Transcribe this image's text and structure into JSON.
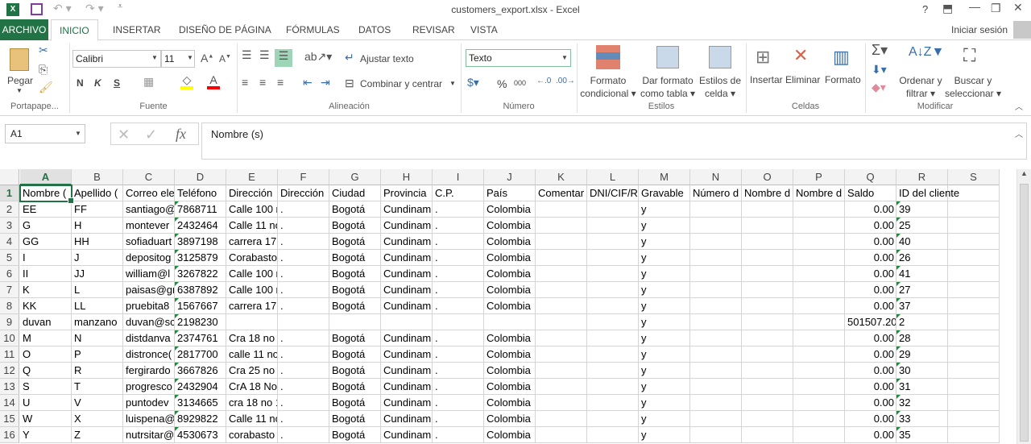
{
  "window": {
    "title": "customers_export.xlsx - Excel",
    "help": "?",
    "signin": "Iniciar sesión"
  },
  "tabs": [
    "ARCHIVO",
    "INICIO",
    "INSERTAR",
    "DISEÑO DE PÁGINA",
    "FÓRMULAS",
    "DATOS",
    "REVISAR",
    "VISTA"
  ],
  "ribbon": {
    "paste": "Pegar",
    "font_name": "Calibri",
    "font_size": "11",
    "bold": "N",
    "italic": "K",
    "underline": "S",
    "wrap": "Ajustar texto",
    "merge": "Combinar y centrar",
    "number_format": "Texto",
    "percent": "%",
    "thousands": "000",
    "cond1": "Formato",
    "cond2": "condicional",
    "table1": "Dar formato",
    "table2": "como tabla",
    "style1": "Estilos de",
    "style2": "celda",
    "insert": "Insertar",
    "delete": "Eliminar",
    "format": "Formato",
    "sort1": "Ordenar y",
    "sort2": "filtrar",
    "find1": "Buscar y",
    "find2": "seleccionar",
    "groups": [
      "Portapape...",
      "Fuente",
      "Alineación",
      "Número",
      "Estilos",
      "Celdas",
      "Modificar"
    ]
  },
  "formula_bar": {
    "name_box": "A1",
    "fx": "fx",
    "value": "Nombre (s)"
  },
  "sheet": {
    "columns": [
      "A",
      "B",
      "C",
      "D",
      "E",
      "F",
      "G",
      "H",
      "I",
      "J",
      "K",
      "L",
      "M",
      "N",
      "O",
      "P",
      "Q",
      "R",
      "S"
    ],
    "selected": "A1",
    "rows": [
      [
        "Nombre (",
        "Apellido (",
        "Correo ele",
        "Teléfono",
        "Dirección",
        "Dirección",
        "Ciudad",
        "Provincia",
        "C.P.",
        "País",
        "Comentar",
        "DNI/CIF/R",
        "Gravable",
        "Número d",
        "Nombre d",
        "Nombre d",
        "Saldo",
        "ID del cliente",
        ""
      ],
      [
        "EE",
        "FF",
        "santiago@",
        "7868711",
        "Calle 100 n",
        ".",
        "Bogotá",
        "Cundinam",
        ".",
        "Colombia",
        "",
        "",
        "y",
        "",
        "",
        "",
        "0.00",
        "39",
        ""
      ],
      [
        "G",
        "H",
        "montever",
        "2432464",
        "Calle 11 no",
        ".",
        "Bogotá",
        "Cundinam",
        ".",
        "Colombia",
        "",
        "",
        "y",
        "",
        "",
        "",
        "0.00",
        "25",
        ""
      ],
      [
        "GG",
        "HH",
        "sofiaduart",
        "3897198",
        "carrera 17",
        ".",
        "Bogotá",
        "Cundinam",
        ".",
        "Colombia",
        "",
        "",
        "y",
        "",
        "",
        "",
        "0.00",
        "40",
        ""
      ],
      [
        "I",
        "J",
        "depositog",
        "3125879",
        "Corabasto",
        ".",
        "Bogotá",
        "Cundinam",
        ".",
        "Colombia",
        "",
        "",
        "y",
        "",
        "",
        "",
        "0.00",
        "26",
        ""
      ],
      [
        "II",
        "JJ",
        "william@l",
        "3267822",
        "Calle 100 n",
        ".",
        "Bogotá",
        "Cundinam",
        ".",
        "Colombia",
        "",
        "",
        "y",
        "",
        "",
        "",
        "0.00",
        "41",
        ""
      ],
      [
        "K",
        "L",
        "paisas@gr",
        "6387892",
        "Calle 100 n",
        ".",
        "Bogotá",
        "Cundinam",
        ".",
        "Colombia",
        "",
        "",
        "y",
        "",
        "",
        "",
        "0.00",
        "27",
        ""
      ],
      [
        "KK",
        "LL",
        "pruebita8",
        "1567667",
        "carrera 17",
        ".",
        "Bogotá",
        "Cundinam",
        ".",
        "Colombia",
        "",
        "",
        "y",
        "",
        "",
        "",
        "0.00",
        "37",
        ""
      ],
      [
        "duvan",
        "manzano",
        "duvan@sc",
        "2198230",
        "",
        "",
        "",
        "",
        "",
        "",
        "",
        "",
        "y",
        "",
        "",
        "",
        "501507.20",
        "2",
        ""
      ],
      [
        "M",
        "N",
        "distdanva",
        "2374761",
        "Cra 18 no 1",
        ".",
        "Bogotá",
        "Cundinam",
        ".",
        "Colombia",
        "",
        "",
        "y",
        "",
        "",
        "",
        "0.00",
        "28",
        ""
      ],
      [
        "O",
        "P",
        "distronce(",
        "2817700",
        "calle 11 no",
        ".",
        "Bogotá",
        "Cundinam",
        ".",
        "Colombia",
        "",
        "",
        "y",
        "",
        "",
        "",
        "0.00",
        "29",
        ""
      ],
      [
        "Q",
        "R",
        "fergirardo",
        "3667826",
        "Cra 25 no 3",
        ".",
        "Bogotá",
        "Cundinam",
        ".",
        "Colombia",
        "",
        "",
        "y",
        "",
        "",
        "",
        "0.00",
        "30",
        ""
      ],
      [
        "S",
        "T",
        "progresco",
        "2432904",
        "CrA 18 No",
        ".",
        "Bogotá",
        "Cundinam",
        ".",
        "Colombia",
        "",
        "",
        "y",
        "",
        "",
        "",
        "0.00",
        "31",
        ""
      ],
      [
        "U",
        "V",
        "puntodev",
        "3134665",
        "cra 18 no 1",
        ".",
        "Bogotá",
        "Cundinam",
        ".",
        "Colombia",
        "",
        "",
        "y",
        "",
        "",
        "",
        "0.00",
        "32",
        ""
      ],
      [
        "W",
        "X",
        "luispena@",
        "8929822",
        "Calle 11 no",
        ".",
        "Bogotá",
        "Cundinam",
        ".",
        "Colombia",
        "",
        "",
        "y",
        "",
        "",
        "",
        "0.00",
        "33",
        ""
      ],
      [
        "Y",
        "Z",
        "nutrsitar@",
        "4530673",
        "corabasto",
        ".",
        "Bogotá",
        "Cundinam",
        ".",
        "Colombia",
        "",
        "",
        "y",
        "",
        "",
        "",
        "0.00",
        "35",
        ""
      ]
    ]
  },
  "colors": {
    "excel_green": "#217346",
    "fill_yellow": "#ffff00",
    "font_red": "#ff0000",
    "error_triangle": "#1e8b3a"
  }
}
